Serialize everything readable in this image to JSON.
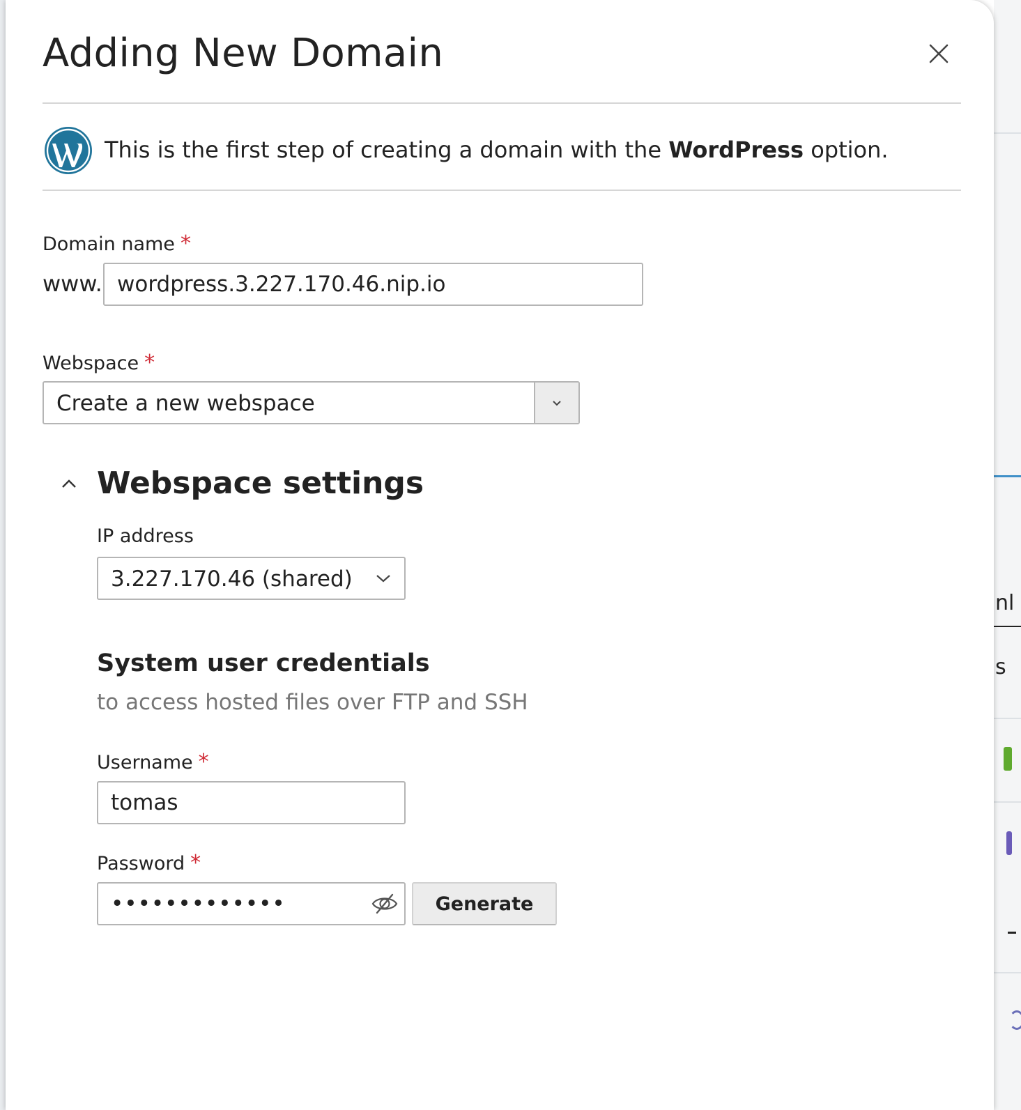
{
  "dialog": {
    "title": "Adding New Domain",
    "close_icon": "close-icon"
  },
  "intro": {
    "icon": "wordpress-logo-icon",
    "text_before": "This is the first step of creating a domain with the ",
    "text_bold": "WordPress",
    "text_after": " option."
  },
  "domain": {
    "label": "Domain name",
    "required_mark": "*",
    "prefix": "www.",
    "value": "wordpress.3.227.170.46.nip.io"
  },
  "webspace": {
    "label": "Webspace",
    "required_mark": "*",
    "selected": "Create a new webspace",
    "dropdown_icon": "chevron-down-icon"
  },
  "webspace_settings": {
    "title": "Webspace settings",
    "collapse_icon": "chevron-up-icon",
    "ip": {
      "label": "IP address",
      "selected": "3.227.170.46 (shared)"
    },
    "credentials": {
      "title": "System user credentials",
      "hint": "to access hosted files over FTP and SSH",
      "username": {
        "label": "Username",
        "required_mark": "*",
        "value": "tomas"
      },
      "password": {
        "label": "Password",
        "required_mark": "*",
        "masked_value": "•••••••••••••",
        "toggle_icon": "eye-slash-icon",
        "generate_label": "Generate"
      }
    }
  },
  "colors": {
    "required": "#d02c37",
    "wordpress_blue": "#21759b",
    "hint_text": "#767676"
  },
  "background": {
    "right_fragments": [
      "nl",
      "s"
    ]
  }
}
